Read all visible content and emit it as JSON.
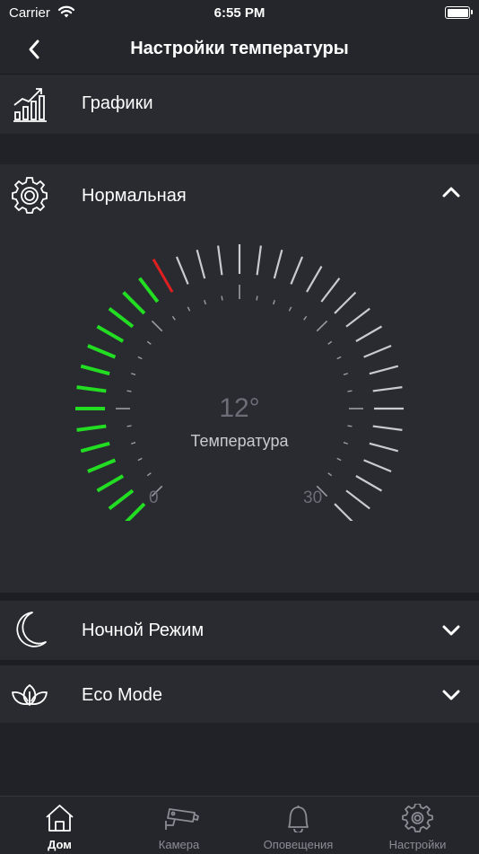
{
  "status_bar": {
    "carrier": "Carrier",
    "time": "6:55 PM"
  },
  "nav": {
    "title": "Настройки температуры"
  },
  "rows": {
    "graphs": {
      "label": "Графики",
      "icon": "chart-icon"
    },
    "normal": {
      "label": "Нормальная",
      "icon": "gear-icon",
      "expanded": true
    },
    "night": {
      "label": "Ночной Режим",
      "icon": "moon-icon",
      "expanded": false
    },
    "eco": {
      "label": "Eco Mode",
      "icon": "leaf-icon",
      "expanded": false
    }
  },
  "gauge": {
    "value": 12,
    "value_label": "12°",
    "caption": "Температура",
    "min": 0,
    "max": 30,
    "min_label": "0",
    "max_label": "30",
    "colors": {
      "active": "#22dd22",
      "pointer": "#e02020",
      "inactive": "#c9cbd1",
      "minor": "#9a9da4"
    }
  },
  "tabs": [
    {
      "label": "Дом",
      "icon": "home-icon",
      "active": true
    },
    {
      "label": "Камера",
      "icon": "camera-icon",
      "active": false
    },
    {
      "label": "Оповещения",
      "icon": "bell-icon",
      "active": false
    },
    {
      "label": "Настройки",
      "icon": "settings-icon",
      "active": false
    }
  ]
}
